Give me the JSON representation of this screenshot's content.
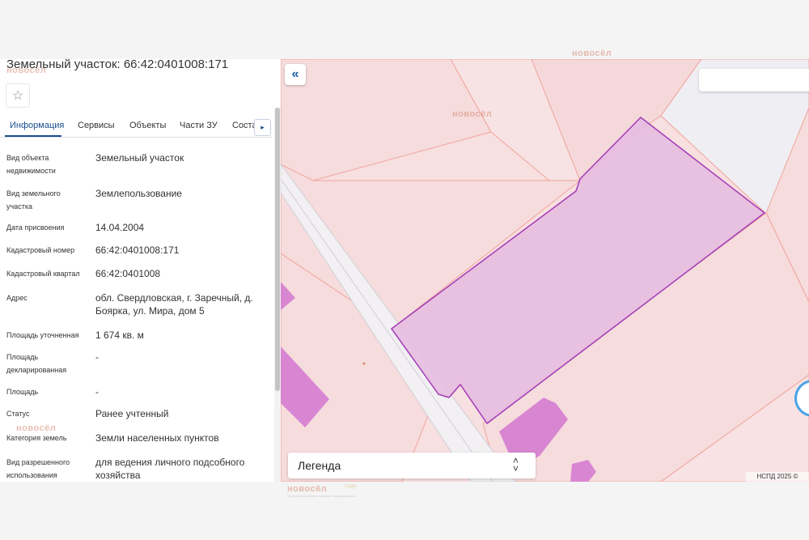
{
  "panel": {
    "title": "Земельный участок: 66:42:0401008:171",
    "tabs": [
      {
        "label": "Информация",
        "active": true
      },
      {
        "label": "Сервисы"
      },
      {
        "label": "Объекты"
      },
      {
        "label": "Части ЗУ"
      },
      {
        "label": "Соста"
      }
    ],
    "rows": [
      {
        "label": "Вид объекта недвижимости",
        "value": "Земельный участок"
      },
      {
        "label": "Вид земельного участка",
        "value": "Землепользование"
      },
      {
        "label": "Дата присвоения",
        "value": "14.04.2004"
      },
      {
        "label": "Кадастровый номер",
        "value": "66:42:0401008:171"
      },
      {
        "label": "Кадастровый квартал",
        "value": "66:42:0401008"
      },
      {
        "label": "Адрес",
        "value": "обл. Свердловская, г. Заречный, д. Боярка, ул. Мира, дом 5"
      },
      {
        "label": "Площадь уточненная",
        "value": "1 674 кв. м"
      },
      {
        "label": "Площадь декларированная",
        "value": "-"
      },
      {
        "label": "Площадь",
        "value": "-"
      },
      {
        "label": "Статус",
        "value": "Ранее учтенный"
      },
      {
        "label": "Категория земель",
        "value": "Земли населенных пунктов"
      },
      {
        "label": "Вид разрешенного использования",
        "value": "для ведения личного подсобного хозяйства"
      }
    ]
  },
  "map": {
    "legend_label": "Легенда",
    "copyright": "НСПД 2025 ©",
    "highlight_color": "#e6bde0"
  },
  "watermark": {
    "name": "новосёл",
    "sub": "Профессиональные новинки о недвижимости",
    "badge": "ГОДА"
  }
}
